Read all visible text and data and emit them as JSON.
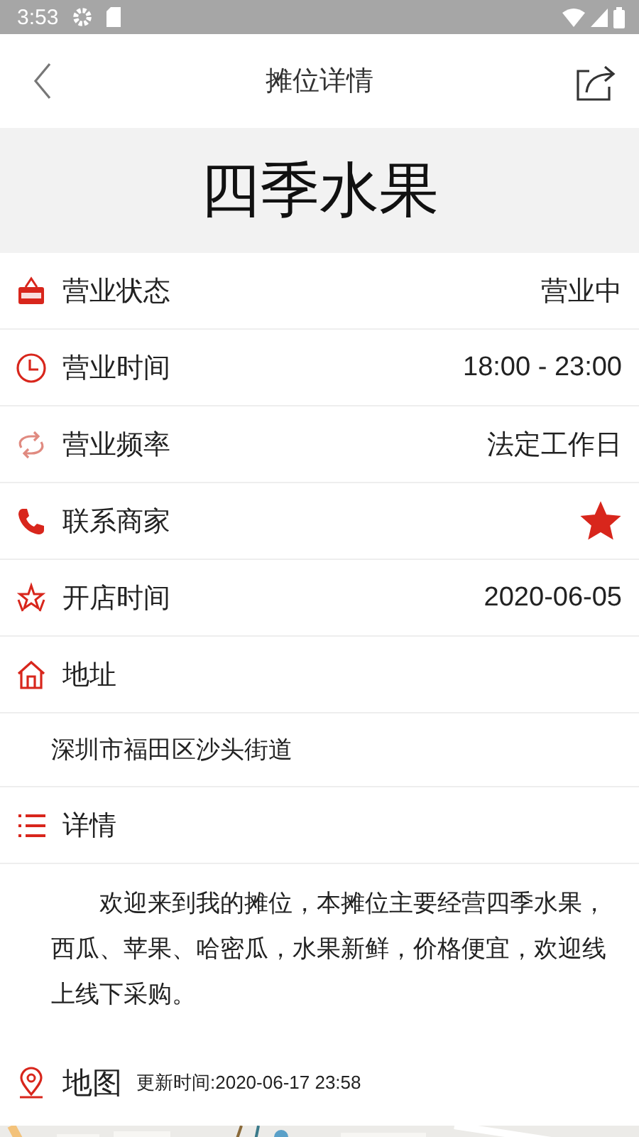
{
  "status_bar": {
    "time": "3:53"
  },
  "header": {
    "title": "摊位详情"
  },
  "banner": {
    "title": "四季水果"
  },
  "info_rows": [
    {
      "label": "营业状态",
      "value": "营业中"
    },
    {
      "label": "营业时间",
      "value": "18:00 - 23:00"
    },
    {
      "label": "营业频率",
      "value": "法定工作日"
    },
    {
      "label": "联系商家",
      "starred": true
    },
    {
      "label": "开店时间",
      "value": "2020-06-05"
    }
  ],
  "address": {
    "label": "地址",
    "text": "深圳市福田区沙头街道"
  },
  "details": {
    "label": "详情",
    "text": "欢迎来到我的摊位，本摊位主要经营四季水果，西瓜、苹果、哈密瓜，水果新鲜，价格便宜，欢迎线上线下采购。"
  },
  "map": {
    "label": "地图",
    "updated": "更新时间:2020-06-17 23:58",
    "kind": "picture"
  }
}
